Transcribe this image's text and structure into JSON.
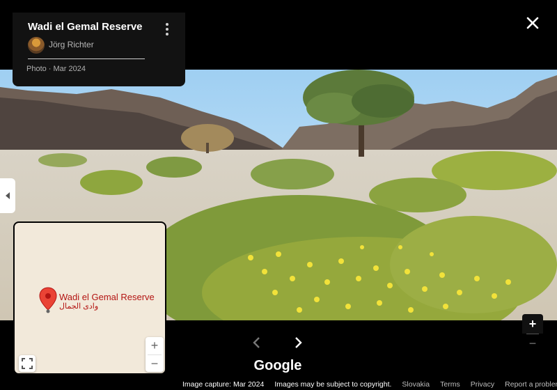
{
  "place": {
    "title": "Wadi el Gemal Reserve",
    "author": "Jörg Richter",
    "photo_meta": "Photo · Mar 2024"
  },
  "map": {
    "label": "Wadi el Gemal Reserve",
    "label_ar": "وادى الجمال",
    "zoom_in": "+",
    "zoom_out": "−"
  },
  "viewer": {
    "zoom_in": "+",
    "zoom_out": "−"
  },
  "brand": "Google",
  "footer": {
    "capture": "Image capture: Mar 2024",
    "copyright": "Images may be subject to copyright.",
    "region": "Slovakia",
    "terms": "Terms",
    "privacy": "Privacy",
    "report": "Report a problem"
  },
  "icons": {
    "close": "close-icon",
    "more": "more-vert-icon",
    "prev": "chevron-left-icon",
    "next": "chevron-right-icon",
    "collapse": "caret-left-icon",
    "fullscreen": "fullscreen-icon",
    "pin": "map-pin-icon"
  },
  "colors": {
    "pin": "#ea4335",
    "map_label": "#b31412",
    "map_bg": "#f2e9da"
  }
}
